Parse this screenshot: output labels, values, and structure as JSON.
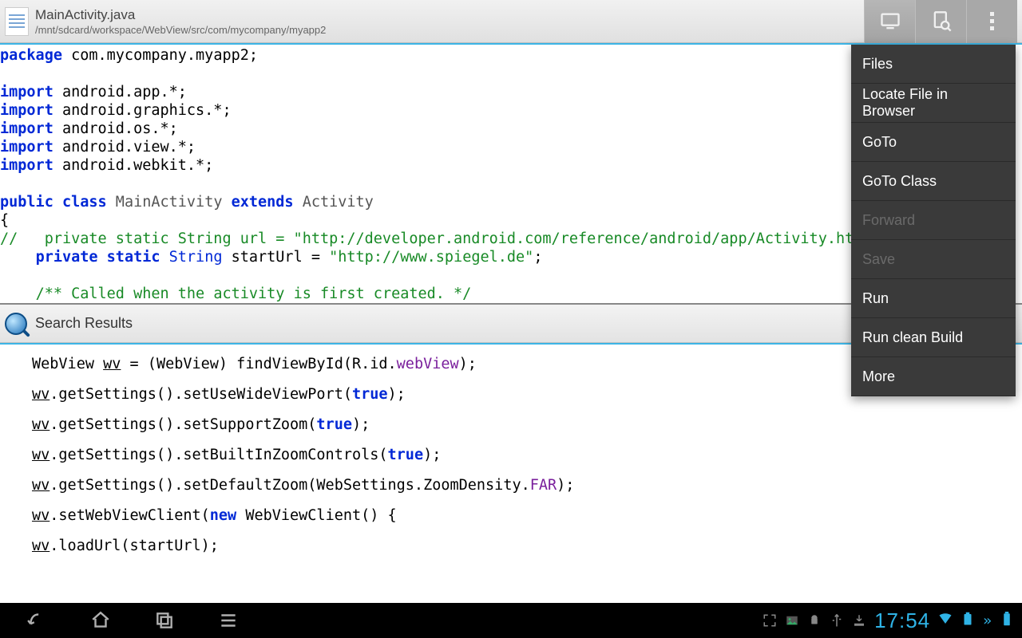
{
  "header": {
    "filename": "MainActivity.java",
    "filepath": "/mnt/sdcard/workspace/WebView/src/com/mycompany/myapp2"
  },
  "menu": {
    "items": [
      {
        "label": "Files",
        "enabled": true
      },
      {
        "label": "Locate File in Browser",
        "enabled": true
      },
      {
        "label": "GoTo",
        "enabled": true
      },
      {
        "label": "GoTo Class",
        "enabled": true
      },
      {
        "label": "Forward",
        "enabled": false
      },
      {
        "label": "Save",
        "enabled": false
      },
      {
        "label": "Run",
        "enabled": true
      },
      {
        "label": "Run clean Build",
        "enabled": true
      },
      {
        "label": "More",
        "enabled": true
      }
    ]
  },
  "search_results": {
    "title": "Search Results"
  },
  "code": {
    "package_kw": "package",
    "package_name": " com.mycompany.myapp2;",
    "import_kw": "import",
    "imports": [
      " android.app.*;",
      " android.graphics.*;",
      " android.os.*;",
      " android.view.*;",
      " android.webkit.*;"
    ],
    "public_kw": "public",
    "class_kw": "class",
    "class_name": " MainActivity ",
    "extends_kw": "extends",
    "super_name": " Activity",
    "brace": "{",
    "comment_url": "//   private static String url = \"http://developer.android.com/reference/android/app/Activity.html",
    "private_kw": "private",
    "static_kw": "static",
    "string_type": " String",
    "startUrl_name": " startUrl = ",
    "startUrl_value": "\"http://www.spiegel.de\"",
    "semicolon": ";",
    "javadoc": "/** Called when the activity is first created. */"
  },
  "results": {
    "line1_a": "WebView ",
    "line1_wv": "wv",
    "line1_b": " = (WebView) findViewById(R.id.",
    "line1_c": "webView",
    "line1_d": ");",
    "line2_wv": "wv",
    "line2_a": ".getSettings().setUseWideViewPort(",
    "line2_true": "true",
    "line2_b": ");",
    "line3_wv": "wv",
    "line3_a": ".getSettings().setSupportZoom(",
    "line3_true": "true",
    "line3_b": ");",
    "line4_wv": "wv",
    "line4_a": ".getSettings().setBuiltInZoomControls(",
    "line4_true": "true",
    "line4_b": ");",
    "line5_wv": "wv",
    "line5_a": ".getSettings().setDefaultZoom(WebSettings.ZoomDensity.",
    "line5_far": "FAR",
    "line5_b": ");",
    "line6_wv": "wv",
    "line6_a": ".setWebViewClient(",
    "line6_new": "new",
    "line6_b": " WebViewClient() {",
    "line7_wv": "wv",
    "line7_a": ".loadUrl(startUrl);"
  },
  "status": {
    "time": "17:54"
  }
}
